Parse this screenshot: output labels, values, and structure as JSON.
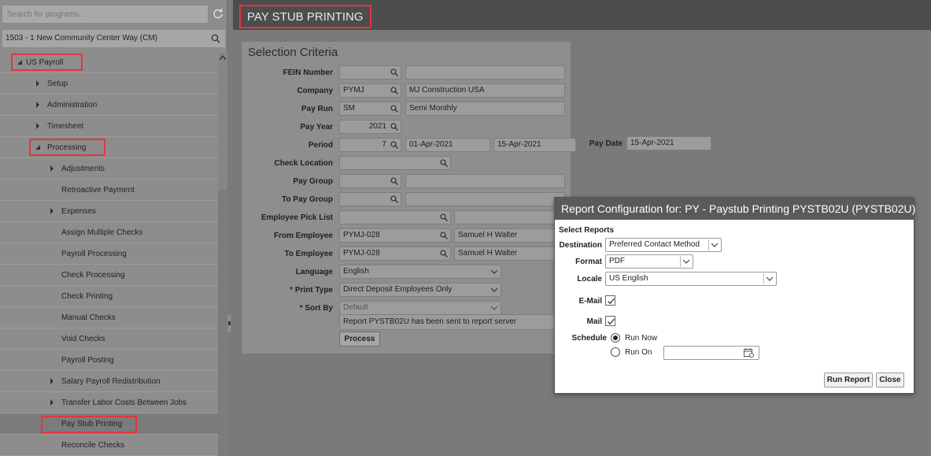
{
  "sidebar": {
    "search_placeholder": "Search for programs...",
    "location": "1503 -  1 New Community Center Way (CM)",
    "items": [
      {
        "label": "US Payroll"
      },
      {
        "label": "Setup"
      },
      {
        "label": "Administration"
      },
      {
        "label": "Timesheet"
      },
      {
        "label": "Processing"
      },
      {
        "label": "Adjustments"
      },
      {
        "label": "Retroactive Payment"
      },
      {
        "label": "Expenses"
      },
      {
        "label": "Assign Multiple Checks"
      },
      {
        "label": "Payroll Processing"
      },
      {
        "label": "Check Processing"
      },
      {
        "label": "Check Printing"
      },
      {
        "label": "Manual Checks"
      },
      {
        "label": "Void Checks"
      },
      {
        "label": "Payroll Posting"
      },
      {
        "label": "Salary Payroll Redistribution"
      },
      {
        "label": "Transfer Labor Costs Between Jobs"
      },
      {
        "label": "Pay Stub Printing"
      },
      {
        "label": "Reconcile Checks"
      }
    ]
  },
  "page": {
    "title": "PAY STUB PRINTING",
    "section_title": "Selection Criteria"
  },
  "form": {
    "fein_label": "FEIN Number",
    "company_label": "Company",
    "company_code": "PYMJ",
    "company_name": "MJ Construction USA",
    "payrun_label": "Pay Run",
    "payrun_code": "SM",
    "payrun_name": "Semi Monthly",
    "payyear_label": "Pay Year",
    "payyear_value": "2021",
    "period_label": "Period",
    "period_value": "7",
    "period_start": "01-Apr-2021",
    "period_end": "15-Apr-2021",
    "paydate_label": "Pay Date",
    "paydate_value": "15-Apr-2021",
    "checkloc_label": "Check Location",
    "paygroup_label": "Pay Group",
    "topaygroup_label": "To Pay Group",
    "picklist_label": "Employee Pick List",
    "fromemp_label": "From Employee",
    "fromemp_code": "PYMJ-028",
    "fromemp_name": "Samuel H Walter",
    "toemp_label": "To Employee",
    "toemp_code": "PYMJ-028",
    "toemp_name": "Samuel H Walter",
    "language_label": "Language",
    "language_value": "English",
    "printtype_label": "* Print Type",
    "printtype_value": "Direct Deposit Employees Only",
    "sortby_label": "* Sort By",
    "sortby_value": "Default",
    "status_message": "Report PYSTB02U has been sent to report server",
    "process_label": "Process"
  },
  "dialog": {
    "title": "Report Configuration for: PY - Paystub Printing PYSTB02U (PYSTB02U)",
    "select_reports": "Select Reports",
    "destination_label": "Destination",
    "destination_value": "Preferred Contact Method",
    "format_label": "Format",
    "format_value": "PDF",
    "locale_label": "Locale",
    "locale_value": "US English",
    "email_label": "E-Mail",
    "mail_label": "Mail",
    "schedule_label": "Schedule",
    "run_now_label": "Run Now",
    "run_on_label": "Run On",
    "run_report_label": "Run Report",
    "close_label": "Close"
  },
  "colors": {
    "highlight": "#e8333f",
    "title_bar": "#4d4d4d",
    "dialog_header": "#5a5a5a"
  }
}
